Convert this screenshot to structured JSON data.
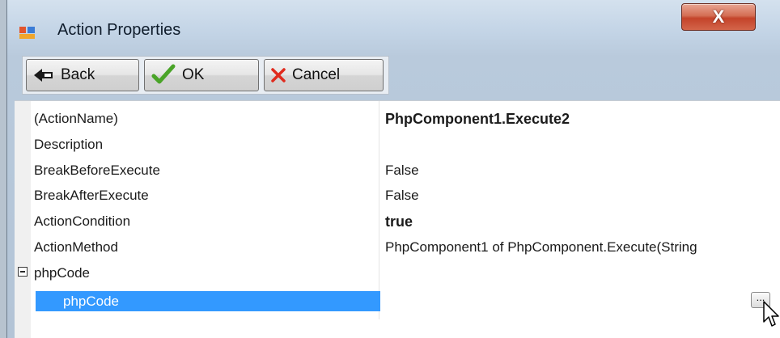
{
  "window": {
    "title": "Action Properties",
    "close_label": "X"
  },
  "toolbar": {
    "back_label": "Back",
    "ok_label": "OK",
    "cancel_label": "Cancel"
  },
  "properties": [
    {
      "name": "(ActionName)",
      "value": "PhpComponent1.Execute2",
      "bold": true
    },
    {
      "name": "Description",
      "value": ""
    },
    {
      "name": "BreakBeforeExecute",
      "value": "False"
    },
    {
      "name": "BreakAfterExecute",
      "value": "False"
    },
    {
      "name": "ActionCondition",
      "value": "true",
      "bold": true
    },
    {
      "name": "ActionMethod",
      "value": "PhpComponent1 of PhpComponent.Execute(String"
    }
  ],
  "category": {
    "name": "phpCode",
    "child": "phpCode",
    "ellipsis": "..."
  },
  "colors": {
    "selection": "#3399ff",
    "close_button": "#c4432a"
  }
}
